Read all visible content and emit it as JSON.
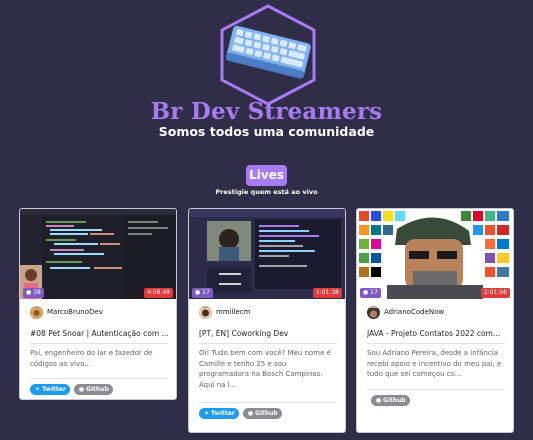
{
  "header": {
    "title": "Br Dev Streamers",
    "subtitle": "Somos todos uma comunidade"
  },
  "lives": {
    "badge": "Lives",
    "subtitle": "Prestigie quem está ao vivo"
  },
  "colors": {
    "background": "#2f2d47",
    "accent": "#a77cf2",
    "live_time": "#e23a3a",
    "twitter": "#1d9bf0",
    "github": "#8b8b92"
  },
  "cards": [
    {
      "viewers": "38",
      "time": "4:08:49",
      "author": "MarcoBrunoDev",
      "title": "#08 Pet Snoar | Autenticação com ...",
      "description": "Pai, engenheiro do lar e fazedor de códigos ao vivo...",
      "buttons": {
        "twitter": "Twitter",
        "github": "Github"
      }
    },
    {
      "viewers": "17",
      "time": "1:01:38",
      "author": "mmillecm",
      "title": "[PT, EN] Coworking Dev",
      "description": "Oi! Tudo bem com você? Meu nome é Camille e tenho 25 e sou programadora na Bosch Campinas. Aqui na l...",
      "buttons": {
        "twitter": "Twitter",
        "github": "Github"
      }
    },
    {
      "viewers": "17",
      "time": "2:01:56",
      "author": "AdrianoCodeNow",
      "title": "JAVA - Projeto Contatos 2022 com...",
      "description": "Sou Adriano Pereira, desde a infância recebi apoio e incentivo do meu pai, e tudo que sei começou co...",
      "buttons": {
        "github": "Github"
      }
    }
  ],
  "icons": {
    "logo": "keyboard-hexagon-logo",
    "viewers": "eye-icon",
    "twitter": "twitter-bird-icon",
    "github": "github-octocat-icon"
  }
}
